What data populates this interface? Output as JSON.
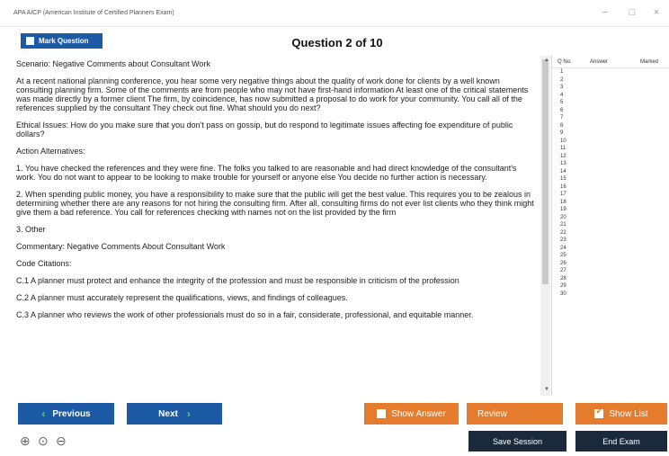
{
  "window": {
    "title": "APA AICP (American Institute of Certified Planners Exam)",
    "minimize": "−",
    "maximize": "□",
    "close": "×"
  },
  "header": {
    "mark_label": "Mark Question",
    "question_title": "Question 2 of 10"
  },
  "content": {
    "paragraphs": [
      "Scenario: Negative Comments about Consultant Work",
      "At a recent national planning conference, you hear some very negative things about the quality of work done for clients by a well known consulting planning firm. Some of the comments are from people who may not have first-hand information At least one of the critical statements was made directly by a former client The firm, by coincidence, has now submitted a proposal to do work for your community. You call all of the references supplied by the consultant They check out fine. What should you do next?",
      "Ethical Issues: How do you make sure that you don't pass on gossip, but do respond to legitimate issues affecting foe expenditure of public dollars?",
      "Action Alternatives:",
      "1. You have checked the references and they were fine. The folks you talked to are reasonable and had direct knowledge of the consultant's work. You do not want to appear to be looking to make trouble for yourself or anyone else You decide no further action is necessary.",
      "2. When spending public money, you have a responsibility to make sure that the public will get the best value. This requires you to be zealous in determining whether there are any reasons for not hiring the consulting firm. After all, consulting firms do not ever list clients who they think might give them a bad reference. You call for references checking with names not on the list provided by the firm",
      "3. Other",
      "Commentary: Negative Comments About Consultant Work",
      "Code Citations:",
      "C.1 A planner must protect and enhance the integrity of the profession and must be responsible in criticism of the profession",
      "C.2 A planner must accurately represent the qualifications, views, and findings of colleagues.",
      "C.3 A planner who reviews the work of other professionals must do so in a fair, considerate, professional, and equitable manner."
    ]
  },
  "question_list": {
    "col_no": "Q No.",
    "col_answer": "Answer",
    "col_marked": "Marked",
    "rows": [
      "1",
      "2",
      "3",
      "4",
      "5",
      "6",
      "7",
      "8",
      "9",
      "10",
      "11",
      "12",
      "13",
      "14",
      "15",
      "16",
      "17",
      "18",
      "19",
      "20",
      "21",
      "22",
      "23",
      "24",
      "25",
      "26",
      "27",
      "28",
      "29",
      "30"
    ]
  },
  "footer": {
    "previous": "Previous",
    "next": "Next",
    "show_answer": "Show Answer",
    "review": "Review",
    "show_list": "Show List",
    "save_session": "Save Session",
    "end_exam": "End Exam"
  },
  "colors": {
    "primary_blue": "#1c5aa6",
    "orange": "#e57b2c",
    "dark": "#1a2a3a",
    "chevron_green": "#5fd06e"
  }
}
